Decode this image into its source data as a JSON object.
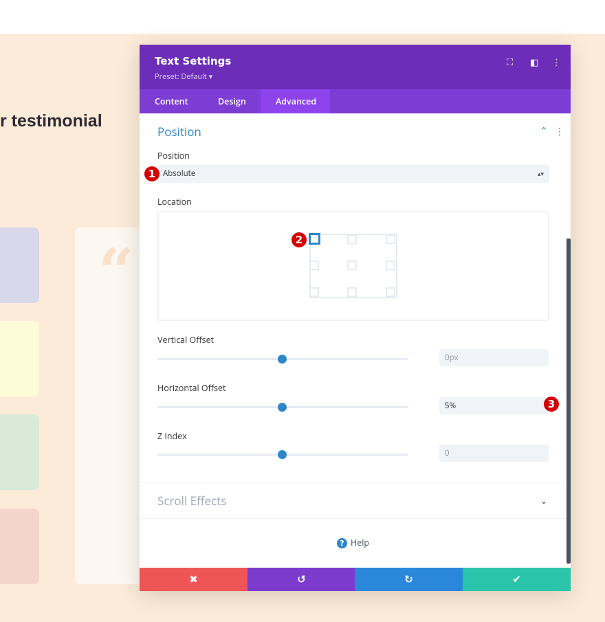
{
  "background": {
    "headline": "r testimonial",
    "card_colors": [
      "#d9d8ea",
      "#fdfbd8",
      "#d9ead8",
      "#f3d5cc"
    ],
    "quote_glyph": "“"
  },
  "panel": {
    "title": "Text Settings",
    "preset": "Preset: Default ▾",
    "header_icons": [
      "fullscreen-icon",
      "split-view-icon",
      "more-options-icon"
    ],
    "tabs": [
      {
        "label": "Content"
      },
      {
        "label": "Design"
      },
      {
        "label": "Advanced",
        "active": true
      }
    ],
    "section": {
      "title": "Position",
      "position_label": "Position",
      "position_value": "Absolute",
      "location_label": "Location",
      "location_selected": "top-left",
      "vertical_offset": {
        "label": "Vertical Offset",
        "value": "",
        "placeholder": "0px",
        "slider": 50
      },
      "horizontal_offset": {
        "label": "Horizontal Offset",
        "value": "5%",
        "slider": 50
      },
      "z_index": {
        "label": "Z Index",
        "value": "",
        "placeholder": "0",
        "slider": 50
      }
    },
    "scroll_effects": "Scroll Effects",
    "help": "Help",
    "badges": [
      "1",
      "2",
      "3"
    ],
    "footer": {
      "colors": {
        "cancel": "#ef5555",
        "undo": "#7c3bcc",
        "redo": "#2b87da",
        "save": "#29c4a9"
      }
    }
  }
}
